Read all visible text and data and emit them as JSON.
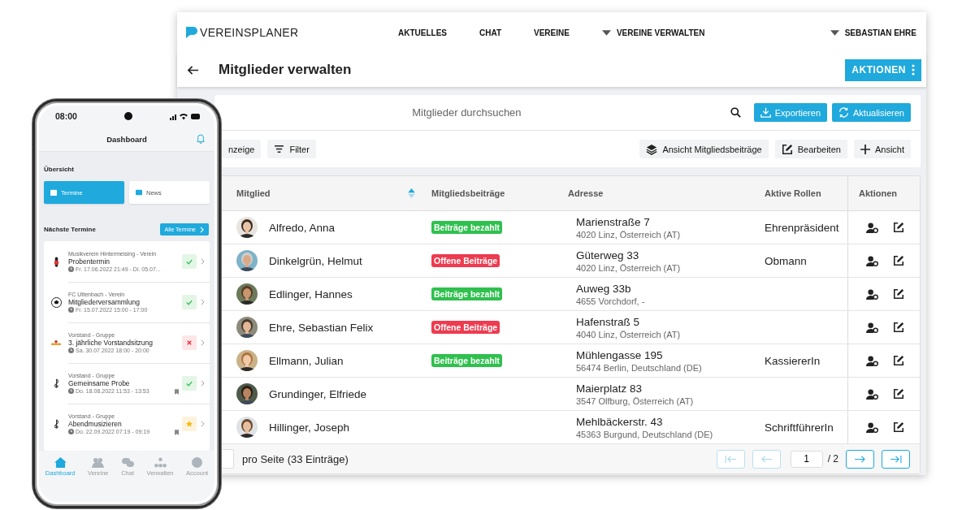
{
  "desktop": {
    "brand": "VEREINSPLANER",
    "nav": [
      {
        "label": "AKTUELLES",
        "dropdown": false
      },
      {
        "label": "CHAT",
        "dropdown": false
      },
      {
        "label": "VEREINE",
        "dropdown": false
      },
      {
        "label": "VEREINE VERWALTEN",
        "dropdown": true
      }
    ],
    "user_menu": {
      "label": "SEBASTIAN EHRE",
      "dropdown": true
    },
    "page_title": "Mitglieder verwalten",
    "actions_button": "AKTIONEN",
    "search": {
      "placeholder": "Mitglieder durchsuchen"
    },
    "search_buttons": [
      "Exportieren",
      "Aktualisieren"
    ],
    "toolbar_left": [
      "nzeige",
      "Filter"
    ],
    "toolbar_right": [
      "Ansicht Mitgliedsbeiträge",
      "Bearbeiten",
      "Ansicht"
    ],
    "table": {
      "columns": [
        "Mitglied",
        "Mitgliedsbeiträge",
        "Adresse",
        "Aktive Rollen",
        "Aktionen"
      ],
      "rows": [
        {
          "name": "Alfredo, Anna",
          "fee": {
            "text": "Beiträge bezahlt",
            "color": "#2fc04e"
          },
          "street": "Marienstraße 7",
          "city": "4020 Linz, Österreich (AT)",
          "role": "Ehrenpräsident"
        },
        {
          "name": "Dinkelgrün, Helmut",
          "fee": {
            "text": "Offene Beiträge",
            "color": "#ee3b4f"
          },
          "street": "Güterweg 33",
          "city": "4020 Linz, Österreich (AT)",
          "role": "Obmann"
        },
        {
          "name": "Edlinger, Hannes",
          "fee": {
            "text": "Beiträge bezahlt",
            "color": "#2fc04e"
          },
          "street": "Auweg 33b",
          "city": "4655 Vorchdorf, -"
        },
        {
          "name": "Ehre, Sebastian Felix",
          "fee": {
            "text": "Offene Beiträge",
            "color": "#ee3b4f"
          },
          "street": "Hafenstraß 5",
          "city": "4040 Linz, Österreich (AT)"
        },
        {
          "name": "Ellmann, Julian",
          "fee": {
            "text": "Beiträge bezahlt",
            "color": "#2fc04e"
          },
          "street": "Mühlengasse 195",
          "city": "56474 Berlin, Deutschland (DE)",
          "role": "KassiererIn"
        },
        {
          "name": "Grundinger, Elfriede",
          "street": "Maierplatz 83",
          "city": "3547 Olfburg, Österreich (AT)"
        },
        {
          "name": "Hillinger, Joseph",
          "street": "Mehlbäckerstr. 43",
          "city": "45363 Burgund, Deutschland (DE)",
          "role": "SchriftführerIn"
        }
      ]
    },
    "pagination": {
      "per_page_label": "pro Seite (33 Einträge)",
      "page": "1",
      "total": "/ 2",
      "buttons": [
        {
          "kind": "first",
          "disabled": true
        },
        {
          "kind": "prev",
          "disabled": true
        },
        {
          "kind": "next",
          "disabled": false
        },
        {
          "kind": "last",
          "disabled": false
        }
      ]
    }
  },
  "phone": {
    "status_time": "08:00",
    "title": "Dashboard",
    "section": "Übersicht",
    "overview_tabs": [
      {
        "label": "Termine",
        "selected": true
      },
      {
        "label": "News",
        "selected": false
      }
    ],
    "upcoming_title": "Nächste Termine",
    "all_button": "Alle Termine",
    "events": [
      {
        "group": "Musikverein Hintermeising - Verein",
        "title": "Probentermin",
        "time": "Fr. 17.06.2022 21:49 - Di. 05.07...",
        "kind": "accepted",
        "tag": false
      },
      {
        "group": "FC Uttenbach - Verein",
        "title": "Mitgliederversammlung",
        "time": "Fr. 15.07.2022 15:00 - 17:00",
        "kind": "accepted",
        "tag": false
      },
      {
        "group": "Vorstand - Gruppe",
        "title": "3. jährliche Vorstandsitzung",
        "time": "Sa. 30.07.2022 18:00 - 20:00",
        "kind": "declined",
        "tag": false
      },
      {
        "group": "Vorstand - Gruppe",
        "title": "Gemeinsame Probe",
        "time": "Do. 18.08.2022 11:53 - 13:53",
        "kind": "accepted",
        "tag": true
      },
      {
        "group": "Vorstand - Gruppe",
        "title": "Abendmusizieren",
        "time": "Do. 22.09.2022 07:19 - 09:19",
        "kind": "favorite",
        "tag": true
      }
    ],
    "tabbar": [
      {
        "label": "Dashboard",
        "selected": true
      },
      {
        "label": "Vereine",
        "selected": false
      },
      {
        "label": "Chat",
        "selected": false
      },
      {
        "label": "Verwalten",
        "selected": false
      },
      {
        "label": "Account",
        "selected": false
      }
    ]
  }
}
